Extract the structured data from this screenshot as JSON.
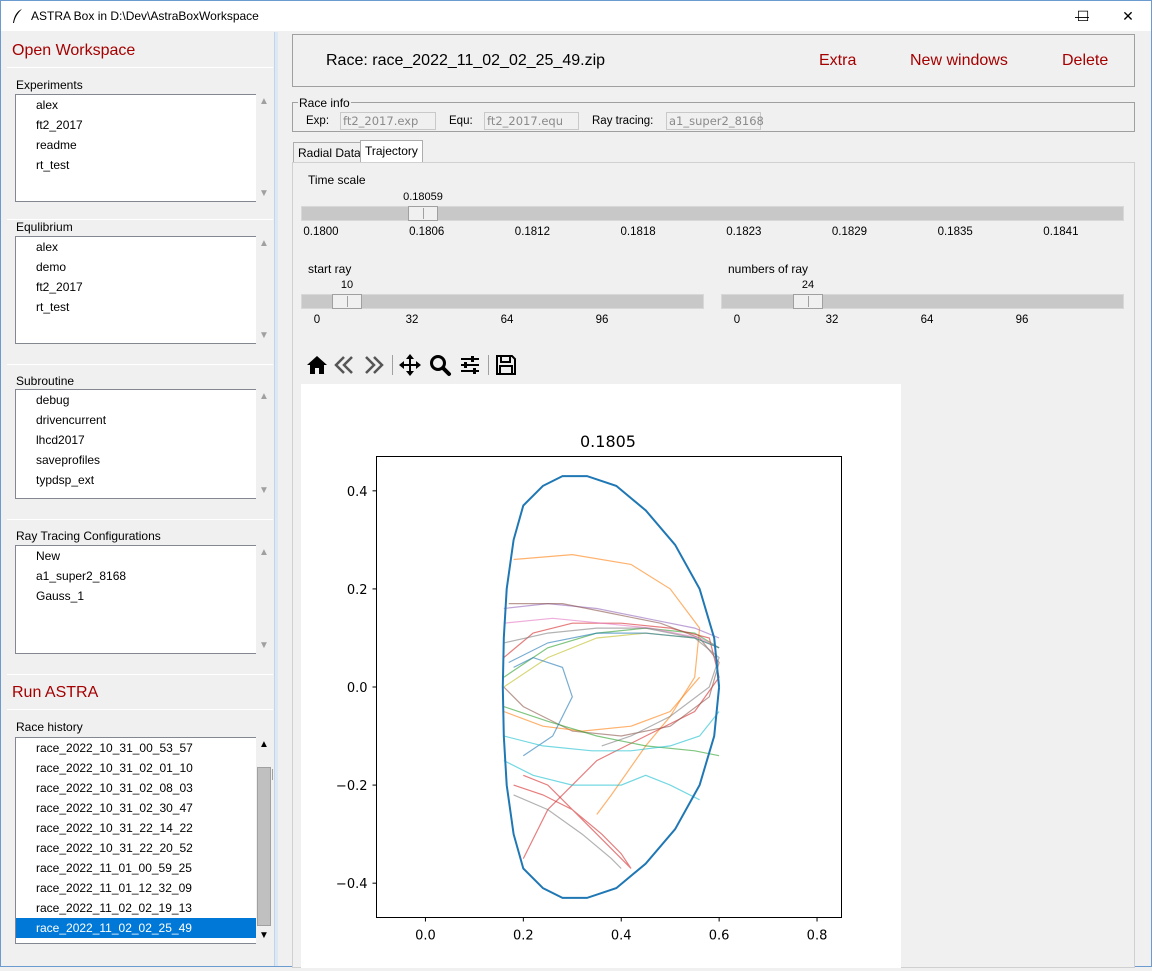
{
  "window": {
    "title": "ASTRA Box in D:\\Dev\\AstraBoxWorkspace",
    "minimize": "—",
    "maximize": "☐",
    "close": "✕"
  },
  "left": {
    "open_workspace": "Open Workspace",
    "experiments": {
      "label": "Experiments",
      "items": [
        "alex",
        "ft2_2017",
        "readme",
        "rt_test"
      ]
    },
    "equilibrium": {
      "label": "Equlibrium",
      "items": [
        "alex",
        "demo",
        "ft2_2017",
        "rt_test"
      ]
    },
    "subroutine": {
      "label": "Subroutine",
      "items": [
        "debug",
        "drivencurrent",
        "lhcd2017",
        "saveprofiles",
        "typdsp_ext"
      ]
    },
    "ray_tracing": {
      "label": "Ray Tracing Configurations",
      "items": [
        "New",
        "a1_super2_8168",
        "Gauss_1"
      ]
    },
    "run_astra": "Run ASTRA",
    "race_history": {
      "label": "Race history",
      "items": [
        "race_2022_10_31_00_53_57",
        "race_2022_10_31_02_01_10",
        "race_2022_10_31_02_08_03",
        "race_2022_10_31_02_30_47",
        "race_2022_10_31_22_14_22",
        "race_2022_10_31_22_20_52",
        "race_2022_11_01_00_59_25",
        "race_2022_11_01_12_32_09",
        "race_2022_11_02_02_19_13",
        "race_2022_11_02_02_25_49"
      ],
      "selected_index": 9
    }
  },
  "header": {
    "race_title": "Race: race_2022_11_02_02_25_49.zip",
    "extra": "Extra",
    "new_windows": "New windows",
    "delete": "Delete"
  },
  "race_info": {
    "title": "Race info",
    "exp_label": "Exp:",
    "exp_value": "ft2_2017.exp",
    "equ_label": "Equ:",
    "equ_value": "ft2_2017.equ",
    "ray_label": "Ray tracing:",
    "ray_value": "a1_super2_8168"
  },
  "tabs": [
    "Radial Data",
    "Trajectory"
  ],
  "active_tab": "Trajectory",
  "time_scale": {
    "label": "Time scale",
    "value": "0.18059",
    "min": 0.18,
    "max": 0.1845,
    "ticks": [
      "0.1800",
      "0.1806",
      "0.1812",
      "0.1818",
      "0.1823",
      "0.1829",
      "0.1835",
      "0.1841"
    ]
  },
  "start_ray": {
    "label": "start ray",
    "value": "10",
    "max": 128,
    "ticks": [
      "0",
      "32",
      "64",
      "96"
    ]
  },
  "numbers_of_ray": {
    "label": "numbers of ray",
    "value": "24",
    "max": 128,
    "ticks": [
      "0",
      "32",
      "64",
      "96"
    ]
  },
  "toolbar": [
    "home-icon",
    "back-icon",
    "forward-icon",
    "pan-icon",
    "zoom-icon",
    "configure-subplots-icon",
    "save-icon"
  ],
  "chart_data": {
    "type": "line",
    "title": "0.1805",
    "xlabel": "",
    "ylabel": "",
    "xlim": [
      -0.1,
      0.85
    ],
    "ylim": [
      -0.47,
      0.47
    ],
    "xticks": [
      "0.0",
      "0.2",
      "0.4",
      "0.6",
      "0.8"
    ],
    "yticks": [
      "0.4",
      "0.2",
      "0.0",
      "−0.2",
      "−0.4"
    ],
    "boundary": {
      "color": "#1f77b4",
      "x": [
        0.6,
        0.59,
        0.56,
        0.51,
        0.45,
        0.39,
        0.33,
        0.28,
        0.24,
        0.2,
        0.18,
        0.166,
        0.16,
        0.158,
        0.16,
        0.166,
        0.18,
        0.2,
        0.24,
        0.28,
        0.33,
        0.39,
        0.45,
        0.51,
        0.56,
        0.59,
        0.6
      ],
      "y": [
        0.0,
        0.1,
        0.2,
        0.29,
        0.36,
        0.41,
        0.43,
        0.43,
        0.41,
        0.37,
        0.3,
        0.2,
        0.1,
        0.0,
        -0.1,
        -0.2,
        -0.3,
        -0.37,
        -0.41,
        -0.43,
        -0.43,
        -0.41,
        -0.36,
        -0.29,
        -0.2,
        -0.1,
        0.0
      ]
    },
    "series": [
      {
        "color": "#ff7f0e",
        "x": [
          0.18,
          0.3,
          0.42,
          0.5,
          0.56,
          0.55,
          0.5,
          0.45,
          0.38,
          0.35
        ],
        "y": [
          0.26,
          0.27,
          0.25,
          0.2,
          0.12,
          0.02,
          -0.06,
          -0.12,
          -0.22,
          -0.26
        ]
      },
      {
        "color": "#2ca02c",
        "x": [
          0.16,
          0.25,
          0.35,
          0.45,
          0.55,
          0.6
        ],
        "y": [
          0.02,
          0.08,
          0.11,
          0.12,
          0.11,
          0.08
        ]
      },
      {
        "color": "#d62728",
        "x": [
          0.16,
          0.22,
          0.3,
          0.4,
          0.5,
          0.58,
          0.6,
          0.55,
          0.45,
          0.35,
          0.25,
          0.2
        ],
        "y": [
          0.06,
          0.11,
          0.13,
          0.13,
          0.12,
          0.1,
          0.02,
          -0.05,
          -0.1,
          -0.15,
          -0.25,
          -0.35
        ]
      },
      {
        "color": "#9467bd",
        "x": [
          0.16,
          0.25,
          0.35,
          0.45,
          0.55,
          0.6
        ],
        "y": [
          0.16,
          0.17,
          0.16,
          0.14,
          0.12,
          0.1
        ]
      },
      {
        "color": "#8c564b",
        "x": [
          0.17,
          0.28,
          0.38,
          0.48,
          0.56,
          0.6,
          0.58,
          0.5,
          0.4,
          0.3,
          0.2,
          0.16
        ],
        "y": [
          0.17,
          0.17,
          0.15,
          0.13,
          0.1,
          0.05,
          -0.02,
          -0.08,
          -0.1,
          -0.09,
          -0.04,
          0.0
        ]
      },
      {
        "color": "#e377c2",
        "x": [
          0.16,
          0.26,
          0.36,
          0.46,
          0.56,
          0.6
        ],
        "y": [
          0.13,
          0.14,
          0.13,
          0.12,
          0.1,
          0.08
        ]
      },
      {
        "color": "#7f7f7f",
        "x": [
          0.16,
          0.25,
          0.35,
          0.45,
          0.55,
          0.6,
          0.58,
          0.5,
          0.42,
          0.36
        ],
        "y": [
          0.09,
          0.11,
          0.12,
          0.12,
          0.1,
          0.06,
          0.0,
          -0.06,
          -0.1,
          -0.12
        ]
      },
      {
        "color": "#bcbd22",
        "x": [
          0.16,
          0.25,
          0.35,
          0.45,
          0.55,
          0.6
        ],
        "y": [
          0.0,
          0.06,
          0.1,
          0.11,
          0.1,
          0.08
        ]
      },
      {
        "color": "#17becf",
        "x": [
          0.16,
          0.22,
          0.3,
          0.4,
          0.45,
          0.5,
          0.56
        ],
        "y": [
          -0.15,
          -0.18,
          -0.2,
          -0.2,
          -0.18,
          -0.2,
          -0.23
        ]
      },
      {
        "color": "#1f77b4",
        "x": [
          0.17,
          0.25,
          0.35,
          0.45,
          0.55,
          0.6
        ],
        "y": [
          0.05,
          0.09,
          0.11,
          0.11,
          0.1,
          0.08
        ]
      },
      {
        "color": "#ff7f0e",
        "x": [
          0.16,
          0.24,
          0.32,
          0.42,
          0.5,
          0.56
        ],
        "y": [
          -0.05,
          -0.08,
          -0.09,
          -0.08,
          -0.05,
          0.02
        ]
      },
      {
        "color": "#2ca02c",
        "x": [
          0.16,
          0.25,
          0.35,
          0.45,
          0.55,
          0.6
        ],
        "y": [
          -0.04,
          -0.07,
          -0.1,
          -0.12,
          -0.13,
          -0.14
        ]
      },
      {
        "color": "#d62728",
        "x": [
          0.18,
          0.24,
          0.3,
          0.36,
          0.4,
          0.42,
          0.4,
          0.35,
          0.3,
          0.25,
          0.2
        ],
        "y": [
          -0.2,
          -0.22,
          -0.25,
          -0.3,
          -0.34,
          -0.37,
          -0.35,
          -0.3,
          -0.25,
          -0.2,
          -0.18
        ]
      },
      {
        "color": "#7f7f7f",
        "x": [
          0.18,
          0.25,
          0.32,
          0.38,
          0.4
        ],
        "y": [
          -0.22,
          -0.25,
          -0.3,
          -0.35,
          -0.37
        ]
      },
      {
        "color": "#1f77b4",
        "x": [
          0.2,
          0.26,
          0.3,
          0.28,
          0.22,
          0.18
        ],
        "y": [
          -0.14,
          -0.1,
          -0.02,
          0.04,
          0.06,
          0.04
        ]
      },
      {
        "color": "#17becf",
        "x": [
          0.16,
          0.24,
          0.34,
          0.42,
          0.5,
          0.56,
          0.6
        ],
        "y": [
          -0.1,
          -0.12,
          -0.13,
          -0.13,
          -0.12,
          -0.1,
          -0.05
        ]
      }
    ]
  }
}
